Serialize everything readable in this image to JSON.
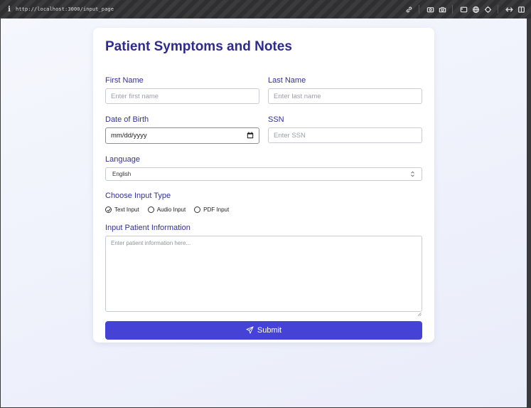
{
  "browser": {
    "url": "http://localhost:3000/input_page",
    "info_glyph": "i"
  },
  "form": {
    "title": "Patient Symptoms and Notes",
    "first_name": {
      "label": "First Name",
      "placeholder": "Enter first name",
      "value": ""
    },
    "last_name": {
      "label": "Last Name",
      "placeholder": "Enter last name",
      "value": ""
    },
    "date_of_birth": {
      "label": "Date of Birth",
      "value": "mm/dd/yyyy"
    },
    "ssn": {
      "label": "SSN",
      "placeholder": "Enter SSN",
      "value": ""
    },
    "language": {
      "label": "Language",
      "selected": "English"
    },
    "input_type": {
      "label": "Choose Input Type",
      "options": [
        {
          "label": "Text Input",
          "checked": true
        },
        {
          "label": "Audio Input",
          "checked": false
        },
        {
          "label": "PDF Input",
          "checked": false
        }
      ]
    },
    "patient_info": {
      "label": "Input Patient Information",
      "placeholder": "Enter patient information here...",
      "value": ""
    },
    "submit_label": "Submit"
  },
  "colors": {
    "accent": "#4543d6",
    "heading": "#2e2a8f",
    "label": "#33309a"
  }
}
